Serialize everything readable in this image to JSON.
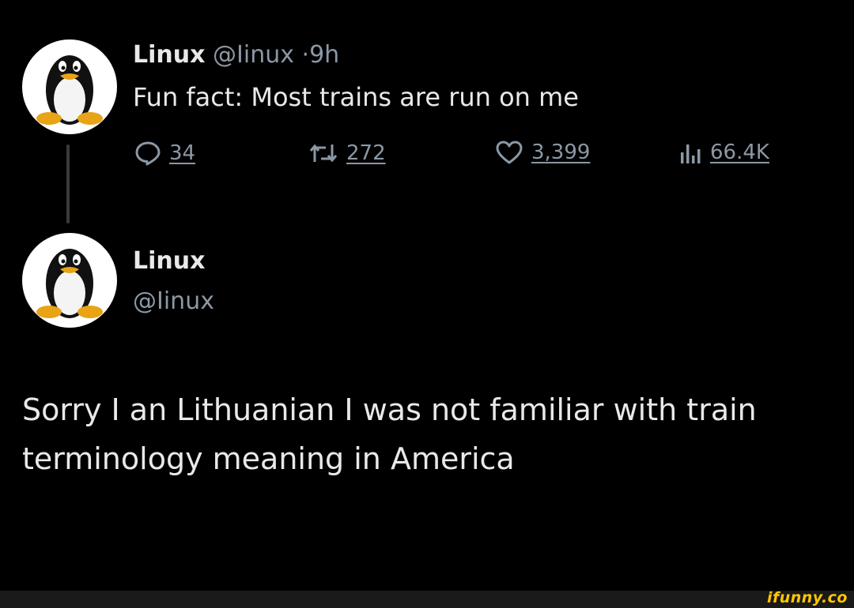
{
  "tweet": {
    "author_name": "Linux",
    "author_handle": "@Iinux",
    "separator": "·",
    "time": "9h",
    "text": "Fun fact: Most trains are run on me",
    "replies": "34",
    "retweets": "272",
    "likes": "3,399",
    "views": "66.4K"
  },
  "reply": {
    "author_name": "Linux",
    "author_handle": "@Iinux",
    "text": "Sorry I an Lithuanian I was not familiar with train terminology meaning in America"
  },
  "watermark": "ifunny.co",
  "icons": {
    "reply": "comment-bubble-icon",
    "retweet": "retweet-icon",
    "like": "heart-icon",
    "views": "bar-chart-icon",
    "avatar": "tux-penguin-icon"
  },
  "colors": {
    "background": "#000000",
    "text": "#e7e9ea",
    "muted": "#8b98a5",
    "watermark": "#ffc700"
  }
}
